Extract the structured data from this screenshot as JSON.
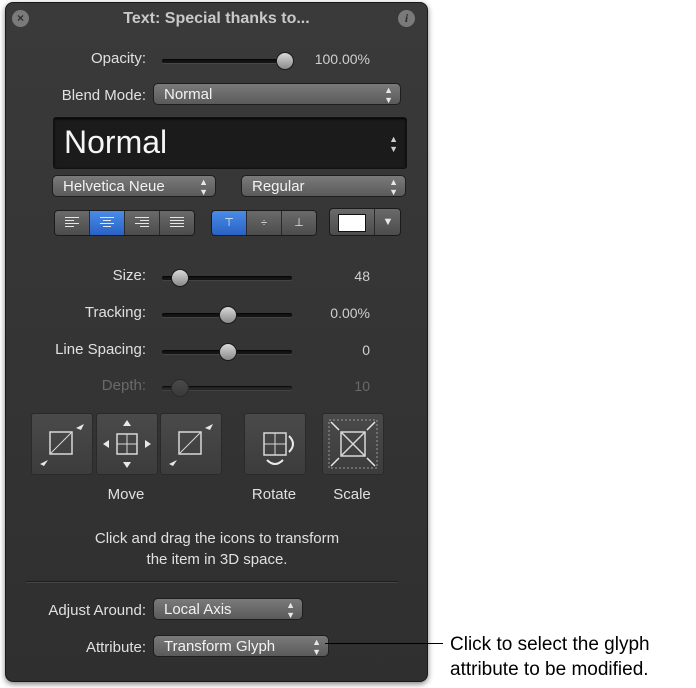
{
  "window": {
    "title": "Text: Special thanks to...",
    "close_glyph": "×",
    "info_glyph": "i"
  },
  "opacity": {
    "label": "Opacity:",
    "value": "100.00%",
    "level": 1.0
  },
  "blend_mode": {
    "label": "Blend Mode:",
    "value": "Normal"
  },
  "style_preset": {
    "value": "Normal"
  },
  "font": {
    "family": "Helvetica Neue",
    "typeface": "Regular"
  },
  "alignment": {
    "horizontal": [
      "align-left",
      "align-center",
      "align-right",
      "justify"
    ],
    "horizontal_selected": "align-center",
    "vertical": [
      "align-top",
      "align-middle",
      "align-bottom"
    ],
    "vertical_selected": "align-top"
  },
  "color": {
    "swatch": "#ffffff"
  },
  "size": {
    "label": "Size:",
    "value": "48",
    "level": 0.08
  },
  "tracking": {
    "label": "Tracking:",
    "value": "0.00%",
    "level": 0.5
  },
  "line_spacing": {
    "label": "Line Spacing:",
    "value": "0",
    "level": 0.5
  },
  "depth": {
    "label": "Depth:",
    "value": "10",
    "level": 0.08,
    "enabled": false
  },
  "transform": {
    "move_label": "Move",
    "rotate_label": "Rotate",
    "scale_label": "Scale",
    "note_line1": "Click and drag the icons to transform",
    "note_line2": "the item in 3D space."
  },
  "adjust_around": {
    "label": "Adjust Around:",
    "value": "Local Axis"
  },
  "attribute": {
    "label": "Attribute:",
    "value": "Transform Glyph"
  },
  "callout": {
    "line1": "Click to select the glyph",
    "line2": "attribute to be modified."
  },
  "colors": {
    "panel": "#333333",
    "accent": "#3b78d8",
    "text": "#e0e0e0"
  }
}
